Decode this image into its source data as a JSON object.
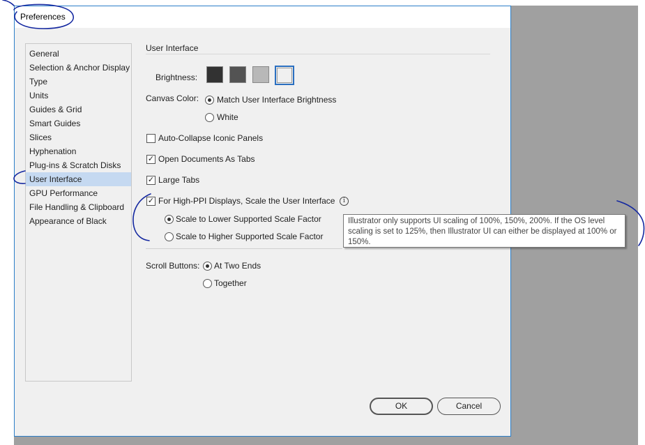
{
  "window": {
    "title": "Preferences"
  },
  "sidebar": {
    "items": [
      {
        "label": "General"
      },
      {
        "label": "Selection & Anchor Display"
      },
      {
        "label": "Type"
      },
      {
        "label": "Units"
      },
      {
        "label": "Guides & Grid"
      },
      {
        "label": "Smart Guides"
      },
      {
        "label": "Slices"
      },
      {
        "label": "Hyphenation"
      },
      {
        "label": "Plug-ins & Scratch Disks"
      },
      {
        "label": "User Interface",
        "selected": true
      },
      {
        "label": "GPU Performance"
      },
      {
        "label": "File Handling & Clipboard"
      },
      {
        "label": "Appearance of Black"
      }
    ]
  },
  "main": {
    "section_title": "User Interface",
    "brightness": {
      "label": "Brightness:",
      "swatches": [
        {
          "color": "#323232",
          "selected": false
        },
        {
          "color": "#535353",
          "selected": false
        },
        {
          "color": "#b8b8b8",
          "selected": false
        },
        {
          "color": "#f0f0f0",
          "selected": true
        }
      ]
    },
    "canvas_color": {
      "label": "Canvas Color:",
      "options": [
        {
          "label": "Match User Interface Brightness",
          "checked": true
        },
        {
          "label": "White",
          "checked": false
        }
      ]
    },
    "auto_collapse": {
      "label": "Auto-Collapse Iconic Panels",
      "checked": false
    },
    "open_as_tabs": {
      "label": "Open Documents As Tabs",
      "checked": true
    },
    "large_tabs": {
      "label": "Large Tabs",
      "checked": true
    },
    "high_ppi": {
      "label": "For High-PPI Displays, Scale the User Interface",
      "checked": true,
      "info_icon": "info-icon",
      "options": [
        {
          "label": "Scale to Lower Supported Scale Factor",
          "checked": true
        },
        {
          "label": "Scale to Higher Supported Scale Factor",
          "checked": false
        }
      ]
    },
    "tooltip": "Illustrator only supports UI scaling of 100%, 150%, 200%. If the OS level scaling is set to 125%, then Illustrator UI can either be displayed at 100% or 150%.",
    "scroll_buttons": {
      "label": "Scroll Buttons:",
      "options": [
        {
          "label": "At Two Ends",
          "checked": true
        },
        {
          "label": "Together",
          "checked": false
        }
      ]
    }
  },
  "footer": {
    "ok_label": "OK",
    "cancel_label": "Cancel"
  },
  "colors": {
    "selection": "#c5d9f1",
    "accent": "#2a6fc0",
    "annotation": "#1428a0"
  }
}
